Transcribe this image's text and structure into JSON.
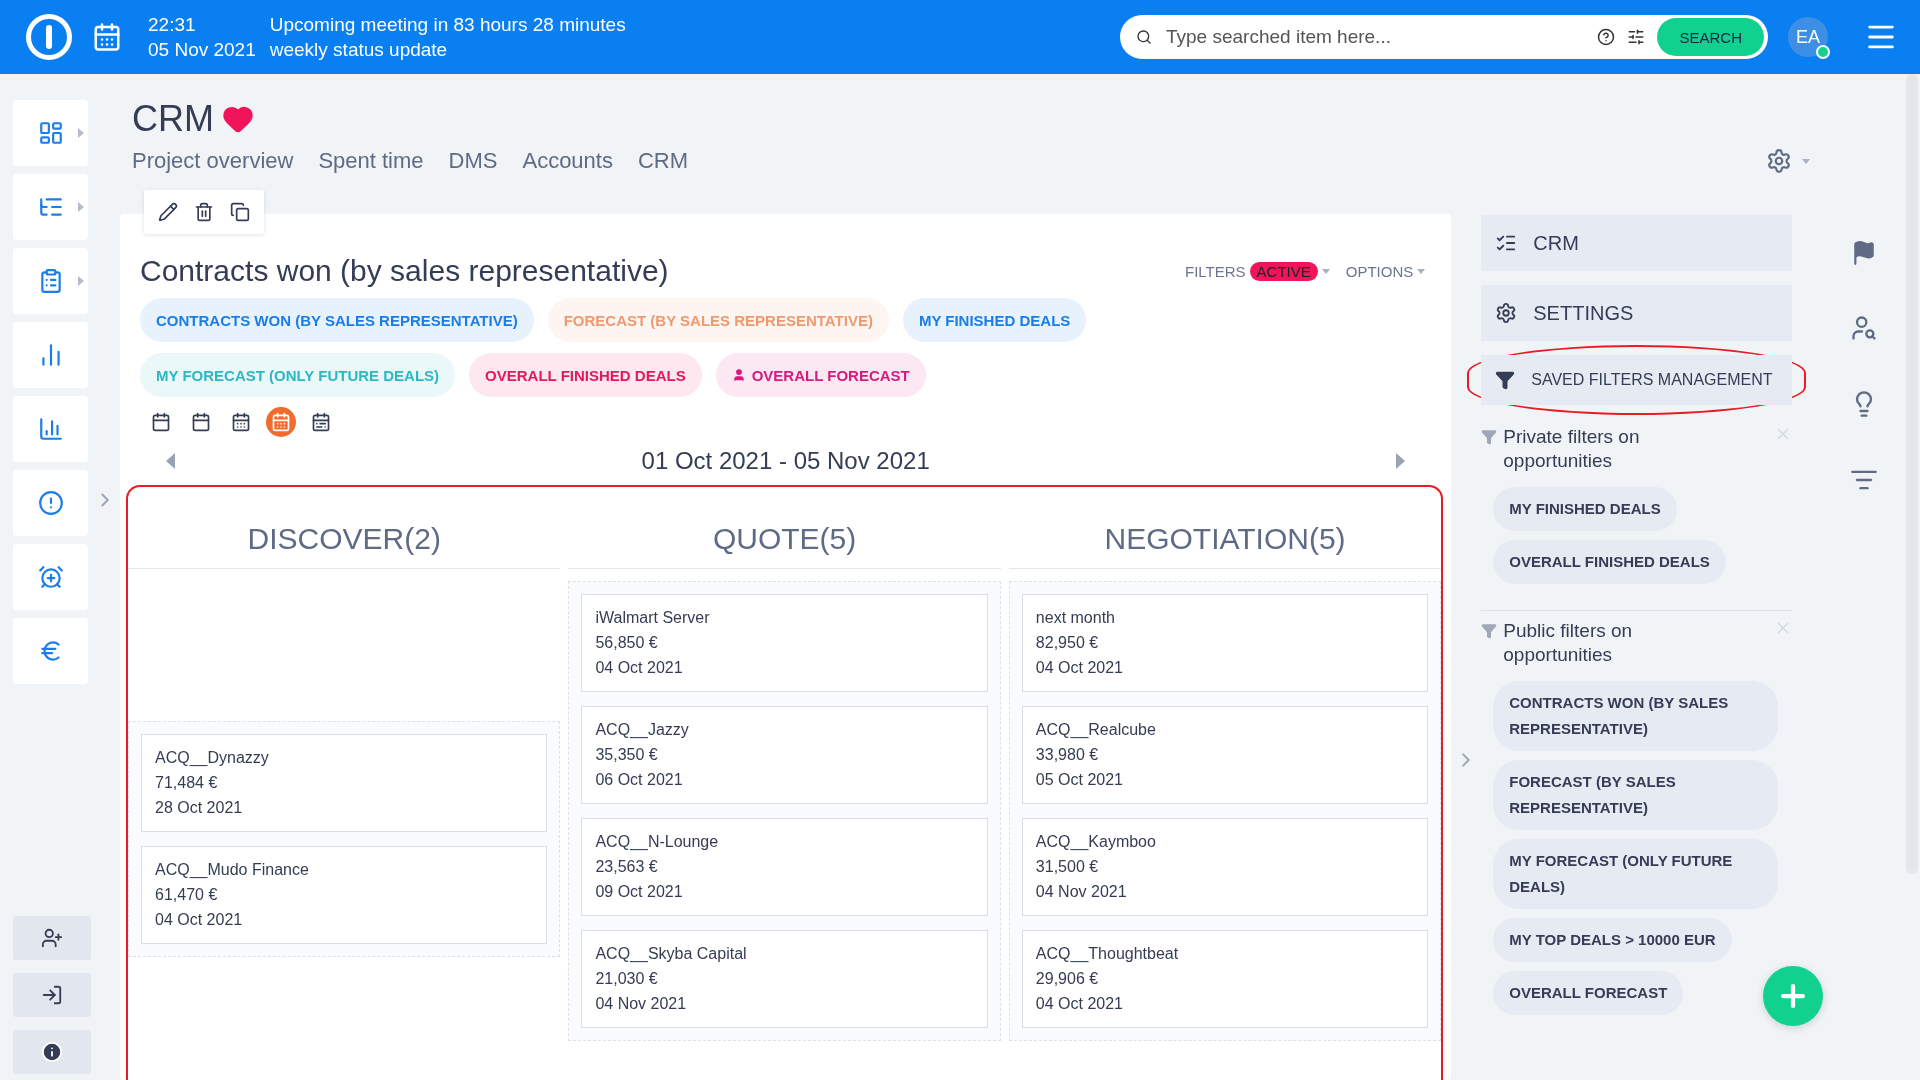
{
  "top_bar": {
    "time": "22:31",
    "meeting": "Upcoming meeting in 83 hours 28 minutes",
    "date": "05 Nov 2021",
    "event": "weekly status update",
    "search_placeholder": "Type searched item here...",
    "search_button": "SEARCH",
    "avatar": "EA",
    "online": true
  },
  "sidebar": {
    "items": [
      {
        "expandable": true
      },
      {
        "expandable": true
      },
      {
        "expandable": true
      },
      {
        "expandable": false
      },
      {
        "expandable": false
      },
      {
        "expandable": false
      },
      {
        "expandable": false
      },
      {
        "expandable": false
      }
    ]
  },
  "header": {
    "title": "CRM",
    "favorite": true,
    "tabs": [
      "Project overview",
      "Spent time",
      "DMS",
      "Accounts",
      "CRM"
    ]
  },
  "module": {
    "title": "Contracts won (by sales representative)",
    "filters_label": "FILTERS",
    "filters_badge": "ACTIVE",
    "options_label": "OPTIONS",
    "filter_chips": [
      {
        "label": "CONTRACTS WON (BY SALES REPRESENTATIVE)",
        "color": "#1a7de8",
        "user_icon": false
      },
      {
        "label": "FORECAST (BY SALES REPRESENTATIVE)",
        "color": "#ee9a70",
        "user_icon": false
      },
      {
        "label": "MY FINISHED DEALS",
        "color": "#1a7de8",
        "user_icon": false
      },
      {
        "label": "MY FORECAST (ONLY FUTURE DEALS)",
        "color": "#2bb8c4",
        "user_icon": false
      },
      {
        "label": "OVERALL FINISHED DEALS",
        "color": "#e8175d",
        "user_icon": false
      },
      {
        "label": "OVERALL FORECAST",
        "color": "#d61a7f",
        "user_icon": true
      }
    ],
    "periods": [
      {
        "selected": false
      },
      {
        "selected": false
      },
      {
        "selected": false
      },
      {
        "selected": true
      },
      {
        "selected": false
      }
    ],
    "date_range": "01 Oct 2021 - 05 Nov 2021",
    "columns": [
      {
        "title": "DISCOVER(2)",
        "cards": [
          {
            "name": "ACQ__Dynazzy",
            "amount": "71,484 €",
            "date": "28 Oct 2021"
          },
          {
            "name": "ACQ__Mudo Finance",
            "amount": "61,470 €",
            "date": "04 Oct 2021"
          }
        ]
      },
      {
        "title": "QUOTE(5)",
        "cards": [
          {
            "name": "iWalmart Server",
            "amount": "56,850 €",
            "date": "04 Oct 2021"
          },
          {
            "name": "ACQ__Jazzy",
            "amount": "35,350 €",
            "date": "06 Oct 2021"
          },
          {
            "name": "ACQ__N-Lounge",
            "amount": "23,563 €",
            "date": "09 Oct 2021"
          },
          {
            "name": "ACQ__Skyba Capital",
            "amount": "21,030 €",
            "date": "04 Nov 2021"
          }
        ]
      },
      {
        "title": "NEGOTIATION(5)",
        "cards": [
          {
            "name": "next month",
            "amount": "82,950 €",
            "date": "04 Oct 2021"
          },
          {
            "name": "ACQ__Realcube",
            "amount": "33,980 €",
            "date": "05 Oct 2021"
          },
          {
            "name": "ACQ__Kaymboo",
            "amount": "31,500 €",
            "date": "04 Nov 2021"
          },
          {
            "name": "ACQ__Thoughtbeat",
            "amount": "29,906 €",
            "date": "04 Oct 2021"
          }
        ]
      }
    ]
  },
  "right_panel": {
    "menu": [
      {
        "label": "CRM",
        "kind": "list",
        "highlighted": false
      },
      {
        "label": "SETTINGS",
        "kind": "settings",
        "highlighted": false
      },
      {
        "label": "SAVED FILTERS MANAGEMENT",
        "kind": "filter",
        "highlighted": true
      }
    ],
    "sections": [
      {
        "title": "Private filters on opportunities",
        "filters": [
          "MY FINISHED DEALS",
          "OVERALL FINISHED DEALS"
        ]
      },
      {
        "title": "Public filters on opportunities",
        "filters": [
          "CONTRACTS WON (BY SALES REPRESENTATIVE)",
          "FORECAST (BY SALES REPRESENTATIVE)",
          "MY FORECAST (ONLY FUTURE DEALS)",
          "MY TOP DEALS > 10000 EUR",
          "OVERALL FORECAST"
        ]
      }
    ]
  }
}
